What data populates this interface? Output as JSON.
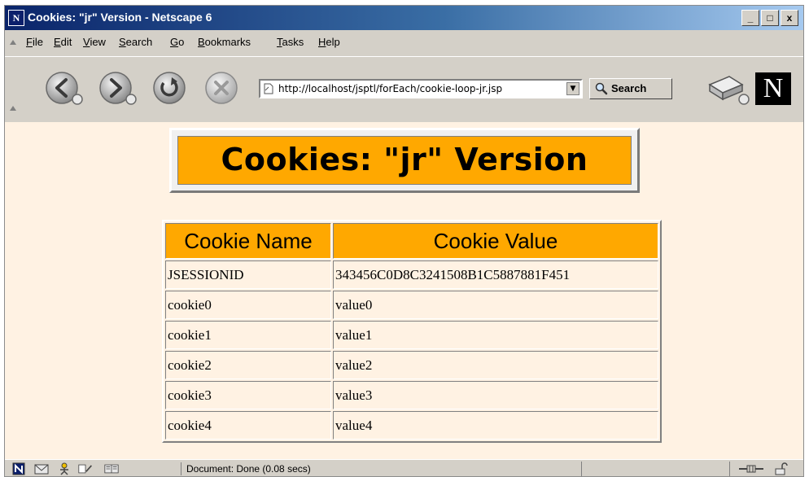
{
  "window": {
    "title": "Cookies: \"jr\" Version - Netscape 6",
    "buttons": [
      "_",
      "□",
      "x"
    ]
  },
  "menubar": {
    "items": [
      {
        "label": "File",
        "accel": "F",
        "rest": "ile"
      },
      {
        "label": "Edit",
        "accel": "E",
        "rest": "dit"
      },
      {
        "label": "View",
        "accel": "V",
        "rest": "iew"
      },
      {
        "label": "Search",
        "accel": "S",
        "rest": "earch"
      },
      {
        "label": "Go",
        "accel": "G",
        "rest": "o"
      },
      {
        "label": "Bookmarks",
        "accel": "B",
        "rest": "ookmarks"
      },
      {
        "label": "Tasks",
        "accel": "T",
        "rest": "asks"
      },
      {
        "label": "Help",
        "accel": "H",
        "rest": "elp"
      }
    ]
  },
  "navbar": {
    "url": "http://localhost/jsptl/forEach/cookie-loop-jr.jsp",
    "search_label": "Search",
    "throbber_letter": "N"
  },
  "page": {
    "heading": "Cookies: \"jr\" Version",
    "table": {
      "headers": [
        "Cookie Name",
        "Cookie Value"
      ],
      "rows": [
        [
          "JSESSIONID",
          "343456C0D8C3241508B1C5887881F451"
        ],
        [
          "cookie0",
          "value0"
        ],
        [
          "cookie1",
          "value1"
        ],
        [
          "cookie2",
          "value2"
        ],
        [
          "cookie3",
          "value3"
        ],
        [
          "cookie4",
          "value4"
        ]
      ]
    }
  },
  "statusbar": {
    "text": "Document: Done (0.08 secs)"
  },
  "colors": {
    "page_background": "#fff2e3",
    "accent_orange": "#ffa800",
    "chrome": "#d4d0c8",
    "titlebar": "#0a246a"
  }
}
